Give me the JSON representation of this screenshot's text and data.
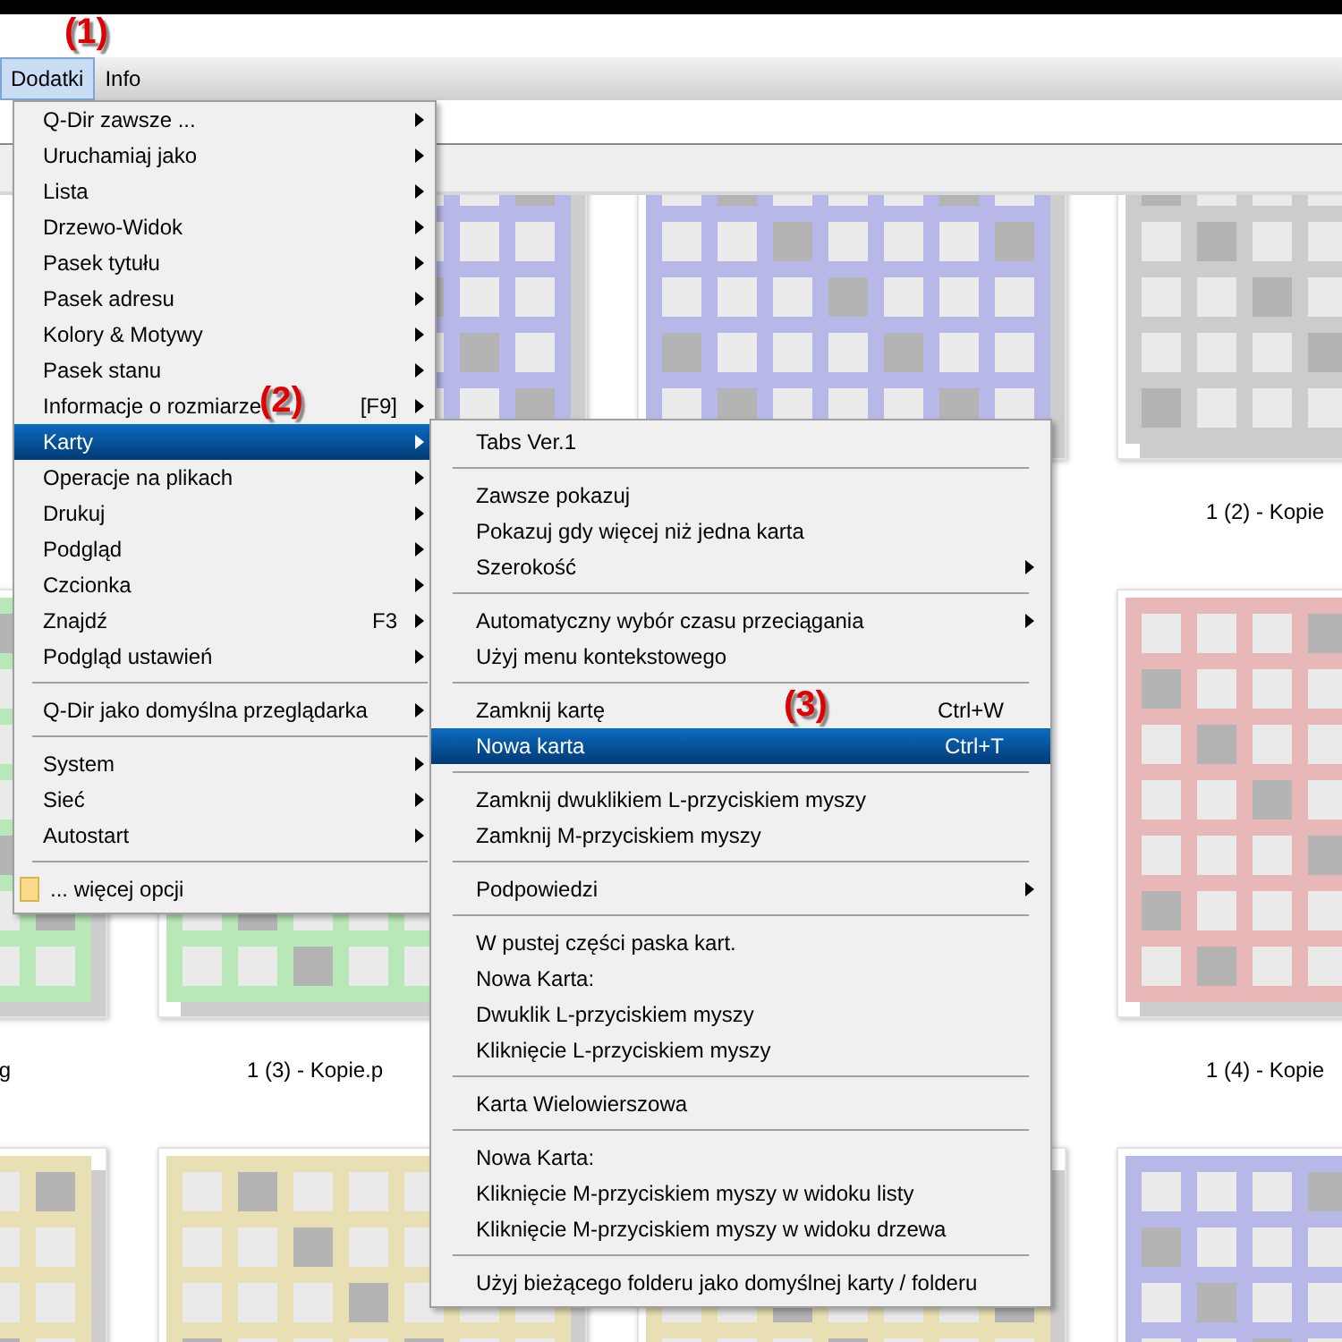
{
  "menu_bar": [
    {
      "label": "Dodatki",
      "selected": true
    },
    {
      "label": "Info",
      "selected": false
    }
  ],
  "thumbnails": [
    {
      "color": "#b8b8e8"
    },
    {
      "color": "#b8b8e8"
    },
    {
      "color": "#cccccc",
      "label": "1 (2) - Kopie"
    },
    {
      "color": "#b8e8b8",
      "label": "g"
    },
    {
      "color": "#b8e8b8",
      "label": "1 (3) - Kopie.p"
    },
    {
      "color": "#e8b8b8",
      "label": "1 (4) - Kopie"
    },
    {
      "color": "#e8e0b4"
    },
    {
      "color": "#e8e0b4"
    },
    {
      "color": "#e8e0b4"
    },
    {
      "color": "#b8b8e8"
    }
  ],
  "main_menu": [
    {
      "kind": "item",
      "label": "Q-Dir zawsze ...",
      "submenu": true,
      "selected": false
    },
    {
      "kind": "item",
      "label": "Uruchamiaj jako",
      "submenu": true,
      "selected": false
    },
    {
      "kind": "item",
      "label": "Lista",
      "submenu": true,
      "selected": false
    },
    {
      "kind": "item",
      "label": "Drzewo-Widok",
      "submenu": true,
      "selected": false
    },
    {
      "kind": "item",
      "label": "Pasek tytułu",
      "submenu": true,
      "selected": false
    },
    {
      "kind": "item",
      "label": "Pasek adresu",
      "submenu": true,
      "selected": false
    },
    {
      "kind": "item",
      "label": "Kolory & Motywy",
      "submenu": true,
      "selected": false
    },
    {
      "kind": "item",
      "label": "Pasek stanu",
      "submenu": true,
      "selected": false
    },
    {
      "kind": "item",
      "label": "Informacje o rozmiarze",
      "shortcut": "[F9]",
      "submenu": true,
      "selected": false
    },
    {
      "kind": "item",
      "label": "Karty",
      "submenu": true,
      "selected": true
    },
    {
      "kind": "item",
      "label": "Operacje na plikach",
      "submenu": true,
      "selected": false
    },
    {
      "kind": "item",
      "label": "Drukuj",
      "submenu": true,
      "selected": false
    },
    {
      "kind": "item",
      "label": "Podgląd",
      "submenu": true,
      "selected": false
    },
    {
      "kind": "item",
      "label": "Czcionka",
      "submenu": true,
      "selected": false
    },
    {
      "kind": "item",
      "label": "Znajdź",
      "shortcut": "F3",
      "submenu": true,
      "selected": false
    },
    {
      "kind": "item",
      "label": "Podgląd ustawień",
      "submenu": true,
      "selected": false
    },
    {
      "kind": "separator"
    },
    {
      "kind": "item",
      "label": "Q-Dir jako domyślna przeglądarka",
      "submenu": true,
      "selected": false
    },
    {
      "kind": "separator"
    },
    {
      "kind": "item",
      "label": "System",
      "submenu": true,
      "selected": false
    },
    {
      "kind": "item",
      "label": "Sieć",
      "submenu": true,
      "selected": false
    },
    {
      "kind": "item",
      "label": "Autostart",
      "submenu": true,
      "selected": false
    },
    {
      "kind": "separator"
    },
    {
      "kind": "folder",
      "label": "... więcej opcji",
      "submenu": false,
      "selected": false
    }
  ],
  "submenu": [
    {
      "kind": "item",
      "label": "Tabs Ver.1",
      "submenu": false,
      "selected": false
    },
    {
      "kind": "separator"
    },
    {
      "kind": "item",
      "label": "Zawsze pokazuj",
      "submenu": false,
      "selected": false
    },
    {
      "kind": "item",
      "label": "Pokazuj gdy więcej niż jedna karta",
      "submenu": false,
      "selected": false
    },
    {
      "kind": "item",
      "label": "Szerokość",
      "submenu": true,
      "selected": false
    },
    {
      "kind": "separator"
    },
    {
      "kind": "item",
      "label": "Automatyczny wybór czasu przeciągania",
      "submenu": true,
      "selected": false
    },
    {
      "kind": "item",
      "label": "Użyj menu kontekstowego",
      "submenu": false,
      "selected": false
    },
    {
      "kind": "separator"
    },
    {
      "kind": "item",
      "label": "Zamknij kartę",
      "shortcut": "Ctrl+W",
      "submenu": false,
      "selected": false
    },
    {
      "kind": "item",
      "label": "Nowa karta",
      "shortcut": "Ctrl+T",
      "submenu": false,
      "selected": true
    },
    {
      "kind": "separator"
    },
    {
      "kind": "item",
      "label": "Zamknij dwuklikiem L-przyciskiem myszy",
      "submenu": false,
      "selected": false
    },
    {
      "kind": "item",
      "label": "Zamknij M-przyciskiem myszy",
      "submenu": false,
      "selected": false
    },
    {
      "kind": "separator"
    },
    {
      "kind": "item",
      "label": "Podpowiedzi",
      "submenu": true,
      "selected": false
    },
    {
      "kind": "separator"
    },
    {
      "kind": "item",
      "label": "W pustej części paska kart.",
      "submenu": false,
      "selected": false
    },
    {
      "kind": "item",
      "label": "Nowa Karta:",
      "submenu": false,
      "selected": false
    },
    {
      "kind": "item",
      "label": "Dwuklik L-przyciskiem myszy",
      "submenu": false,
      "selected": false
    },
    {
      "kind": "item",
      "label": "Kliknięcie L-przyciskiem myszy",
      "submenu": false,
      "selected": false
    },
    {
      "kind": "separator"
    },
    {
      "kind": "item",
      "label": "Karta Wielowierszowa",
      "submenu": false,
      "selected": false
    },
    {
      "kind": "separator"
    },
    {
      "kind": "item",
      "label": "Nowa Karta:",
      "submenu": false,
      "selected": false
    },
    {
      "kind": "item",
      "label": "Kliknięcie M-przyciskiem myszy w widoku listy",
      "submenu": false,
      "selected": false
    },
    {
      "kind": "item",
      "label": "Kliknięcie M-przyciskiem myszy w widoku drzewa",
      "submenu": false,
      "selected": false
    },
    {
      "kind": "separator"
    },
    {
      "kind": "item",
      "label": "Użyj bieżącego folderu jako domyślnej karty / folderu",
      "submenu": false,
      "selected": false
    }
  ],
  "annotations": [
    "(1)",
    "(2)",
    "(3)"
  ]
}
